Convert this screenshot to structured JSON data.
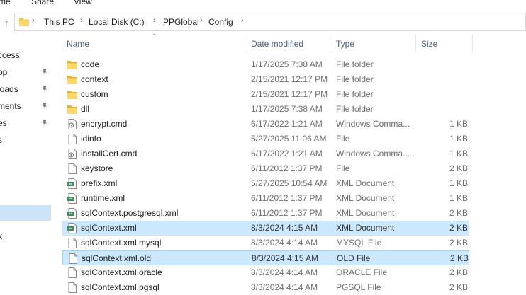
{
  "ribbon": {
    "tabs": [
      "me",
      "Share",
      "View"
    ]
  },
  "address": {
    "crumbs": [
      "This PC",
      "Local Disk (C:)",
      "PPGlobal",
      "Config"
    ]
  },
  "nav": {
    "items": [
      "ccess",
      "op",
      "loads",
      "ments",
      "es",
      "s",
      "",
      "",
      "",
      "",
      "k"
    ]
  },
  "columns": {
    "name": "Name",
    "date": "Date modified",
    "type": "Type",
    "size": "Size"
  },
  "files": [
    {
      "name": "code",
      "date": "1/17/2025 7:38 AM",
      "type": "File folder",
      "size": "",
      "icon": "folder-icon"
    },
    {
      "name": "context",
      "date": "2/15/2021 12:17 PM",
      "type": "File folder",
      "size": "",
      "icon": "folder-icon"
    },
    {
      "name": "custom",
      "date": "2/15/2021 12:17 PM",
      "type": "File folder",
      "size": "",
      "icon": "folder-icon"
    },
    {
      "name": "dll",
      "date": "1/17/2025 7:38 AM",
      "type": "File folder",
      "size": "",
      "icon": "folder-icon"
    },
    {
      "name": "encrypt.cmd",
      "date": "6/17/2022 1:21 AM",
      "type": "Windows Comma...",
      "size": "1 KB",
      "icon": "cmd-file-icon"
    },
    {
      "name": "idinfo",
      "date": "5/27/2025 11:06 AM",
      "type": "File",
      "size": "1 KB",
      "icon": "file-icon"
    },
    {
      "name": "installCert.cmd",
      "date": "6/17/2022 1:21 AM",
      "type": "Windows Comma...",
      "size": "1 KB",
      "icon": "cmd-file-icon"
    },
    {
      "name": "keystore",
      "date": "6/11/2012 1:37 PM",
      "type": "File",
      "size": "2 KB",
      "icon": "file-icon"
    },
    {
      "name": "prefix.xml",
      "date": "5/27/2025 10:54 AM",
      "type": "XML Document",
      "size": "1 KB",
      "icon": "xml-file-icon"
    },
    {
      "name": "runtime.xml",
      "date": "6/11/2012 1:37 PM",
      "type": "XML Document",
      "size": "1 KB",
      "icon": "xml-file-icon"
    },
    {
      "name": "sqlContext.postgresql.xml",
      "date": "6/11/2012 1:37 PM",
      "type": "XML Document",
      "size": "2 KB",
      "icon": "xml-file-icon"
    },
    {
      "name": "sqlContext.xml",
      "date": "8/3/2024 4:15 AM",
      "type": "XML Document",
      "size": "2 KB",
      "icon": "xml-file-icon"
    },
    {
      "name": "sqlContext.xml.mysql",
      "date": "8/3/2024 4:14 AM",
      "type": "MYSQL File",
      "size": "2 KB",
      "icon": "file-icon"
    },
    {
      "name": "sqlContext.xml.old",
      "date": "8/3/2024 4:15 AM",
      "type": "OLD File",
      "size": "2 KB",
      "icon": "file-icon"
    },
    {
      "name": "sqlContext.xml.oracle",
      "date": "8/3/2024 4:14 AM",
      "type": "ORACLE File",
      "size": "2 KB",
      "icon": "file-icon"
    },
    {
      "name": "sqlContext.xml.pgsql",
      "date": "8/3/2024 4:14 AM",
      "type": "PGSQL File",
      "size": "2 KB",
      "icon": "file-icon"
    }
  ]
}
